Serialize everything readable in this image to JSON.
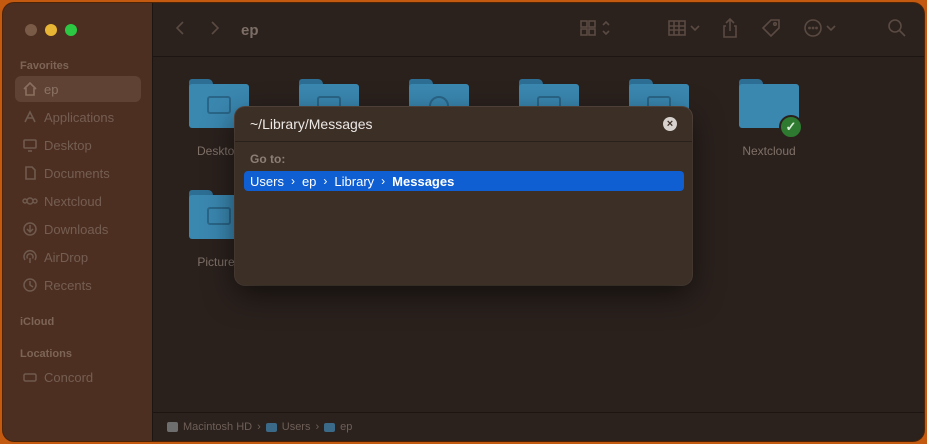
{
  "toolbar": {
    "title": "ep"
  },
  "sidebar": {
    "favorites_header": "Favorites",
    "favorites": [
      {
        "label": "ep",
        "icon": "home-icon"
      },
      {
        "label": "Applications",
        "icon": "applications-icon"
      },
      {
        "label": "Desktop",
        "icon": "desktop-icon"
      },
      {
        "label": "Documents",
        "icon": "document-icon"
      },
      {
        "label": "Nextcloud",
        "icon": "nextcloud-icon"
      },
      {
        "label": "Downloads",
        "icon": "download-icon"
      },
      {
        "label": "AirDrop",
        "icon": "airdrop-icon"
      },
      {
        "label": "Recents",
        "icon": "clock-icon"
      }
    ],
    "icloud_header": "iCloud",
    "locations_header": "Locations",
    "locations": [
      {
        "label": "Concord",
        "icon": "disk-icon"
      }
    ]
  },
  "folders": [
    {
      "label": "Desktop",
      "icon": "desktop-folder-icon"
    },
    {
      "label": "",
      "icon": "documents-folder-icon"
    },
    {
      "label": "",
      "icon": "downloads-folder-icon"
    },
    {
      "label": "",
      "icon": "movies-folder-icon"
    },
    {
      "label": "",
      "icon": "music-folder-icon"
    },
    {
      "label": "Nextcloud",
      "icon": "nextcloud-folder-icon",
      "status": "synced"
    },
    {
      "label": "Pictures",
      "icon": "pictures-folder-icon"
    }
  ],
  "pathbar": {
    "items": [
      "Macintosh HD",
      "Users",
      "ep"
    ],
    "separator": "›"
  },
  "goto_dialog": {
    "path_value": "~/Library/Messages",
    "clear_glyph": "×",
    "label": "Go to:",
    "suggestion": [
      "Users",
      "ep",
      "Library",
      "Messages"
    ],
    "separator": "›"
  },
  "colors": {
    "accent": "#0f5fd2",
    "folder": "#3a87b0",
    "desktop_bg": "#c45a10"
  }
}
